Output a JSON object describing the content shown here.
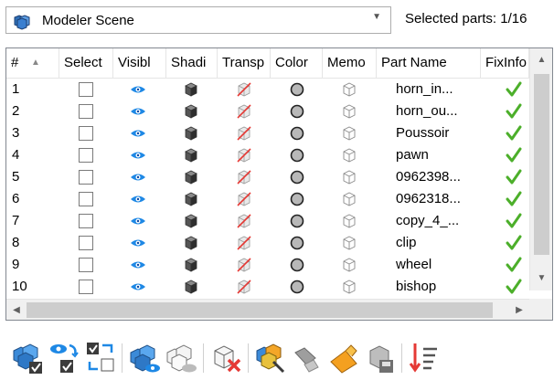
{
  "scene_selector": {
    "value": "Modeler Scene",
    "icon": "scene-icon"
  },
  "selected_parts_label": "Selected parts: 1/16",
  "grid": {
    "columns": [
      "#",
      "Select",
      "Visibl",
      "Shadi",
      "Transp",
      "Color",
      "Memo",
      "Part Name",
      "FixInfo"
    ],
    "rows": [
      {
        "num": "1",
        "name": "horn_in..."
      },
      {
        "num": "2",
        "name": "horn_ou..."
      },
      {
        "num": "3",
        "name": "Poussoir"
      },
      {
        "num": "4",
        "name": "pawn"
      },
      {
        "num": "5",
        "name": "0962398..."
      },
      {
        "num": "6",
        "name": "0962318..."
      },
      {
        "num": "7",
        "name": "copy_4_..."
      },
      {
        "num": "8",
        "name": "clip"
      },
      {
        "num": "9",
        "name": "wheel"
      },
      {
        "num": "10",
        "name": "bishop"
      }
    ]
  },
  "toolbar_icons": [
    "select-all-parts-icon",
    "toggle-visibility-icon",
    "invert-selection-icon",
    "show-parts-icon",
    "hide-parts-icon",
    "delete-parts-icon",
    "color-parts-icon",
    "fill-tool-icon",
    "paint-icon",
    "save-parts-icon",
    "sort-parts-icon"
  ],
  "colors": {
    "check": "#4caf2a",
    "eye": "#1e88e5",
    "border": "#828790"
  }
}
